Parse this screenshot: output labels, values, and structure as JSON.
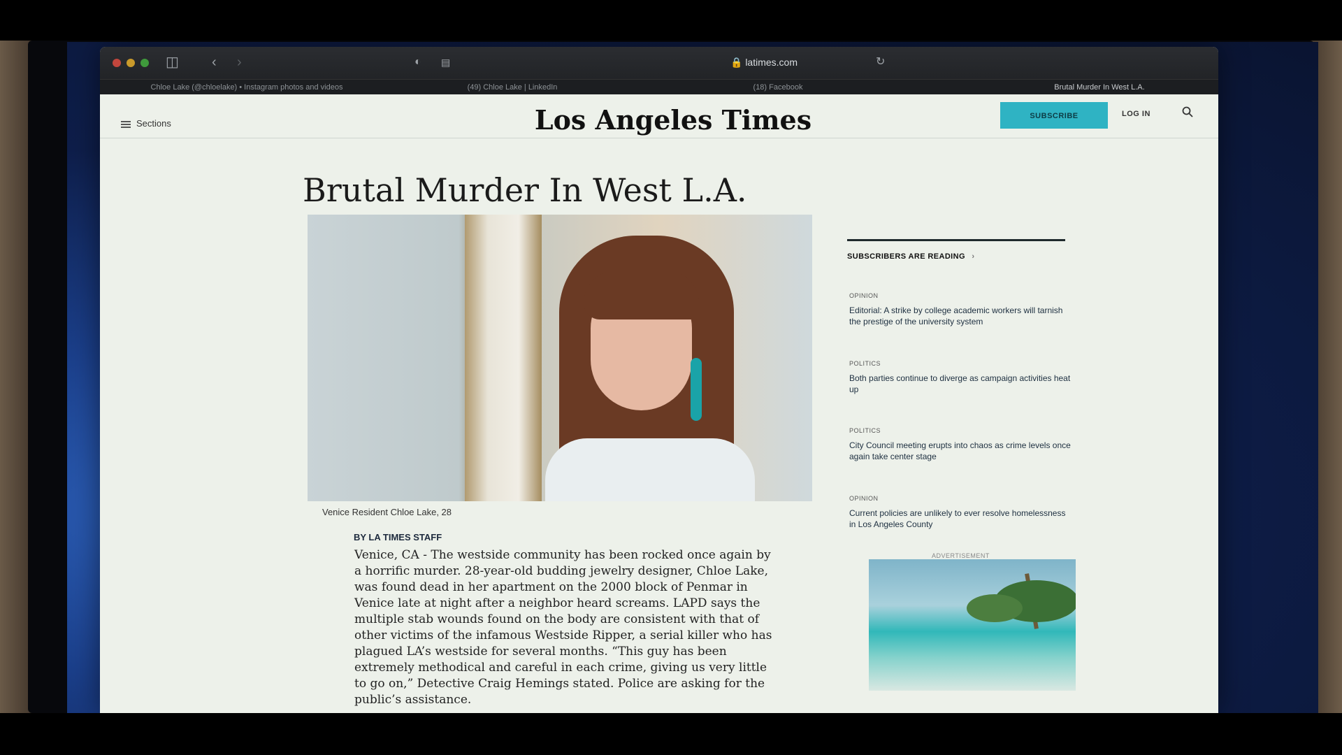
{
  "browser": {
    "address": "latimes.com",
    "tabs": [
      "Chloe Lake (@chloelake) • Instagram photos and videos",
      "(49) Chloe Lake | LinkedIn",
      "(18) Facebook",
      "Brutal Murder In West L.A."
    ]
  },
  "header": {
    "sections_label": "Sections",
    "logo": "Los Angeles Times",
    "subscribe_label": "SUBSCRIBE",
    "login_label": "LOG IN"
  },
  "article": {
    "headline": "Brutal Murder In West L.A.",
    "caption": "Venice Resident Chloe Lake, 28",
    "byline": "BY LA TIMES STAFF",
    "body": "Venice, CA - The westside community has been rocked once again by a horrific murder. 28-year-old budding jewelry designer, Chloe Lake, was found dead in her apartment on the 2000 block of Penmar in Venice late at night after a neighbor heard screams. LAPD says the multiple stab wounds found on the body are consistent with that of other victims of the infamous Westside Ripper, a serial killer who has plagued LA’s westside for several months. “This guy has been extremely methodical and careful in each crime, giving us very little to go on,” Detective Craig Hemings stated. Police are asking for the public’s assistance."
  },
  "sidebar": {
    "title": "SUBSCRIBERS ARE READING",
    "items": [
      {
        "category": "OPINION",
        "link": "Editorial: A strike by college academic workers will tarnish the prestige of the university system"
      },
      {
        "category": "POLITICS",
        "link": "Both parties continue to diverge as campaign activities heat up"
      },
      {
        "category": "POLITICS",
        "link": "City Council meeting erupts into chaos as crime levels once again take center stage"
      },
      {
        "category": "OPINION",
        "link": "Current policies are unlikely to ever resolve homelessness in Los Angeles County"
      }
    ],
    "ad_label": "ADVERTISEMENT"
  },
  "colors": {
    "accent": "#2fb3c3",
    "page_bg": "#edf1ea",
    "chrome": "#2b2d31"
  }
}
